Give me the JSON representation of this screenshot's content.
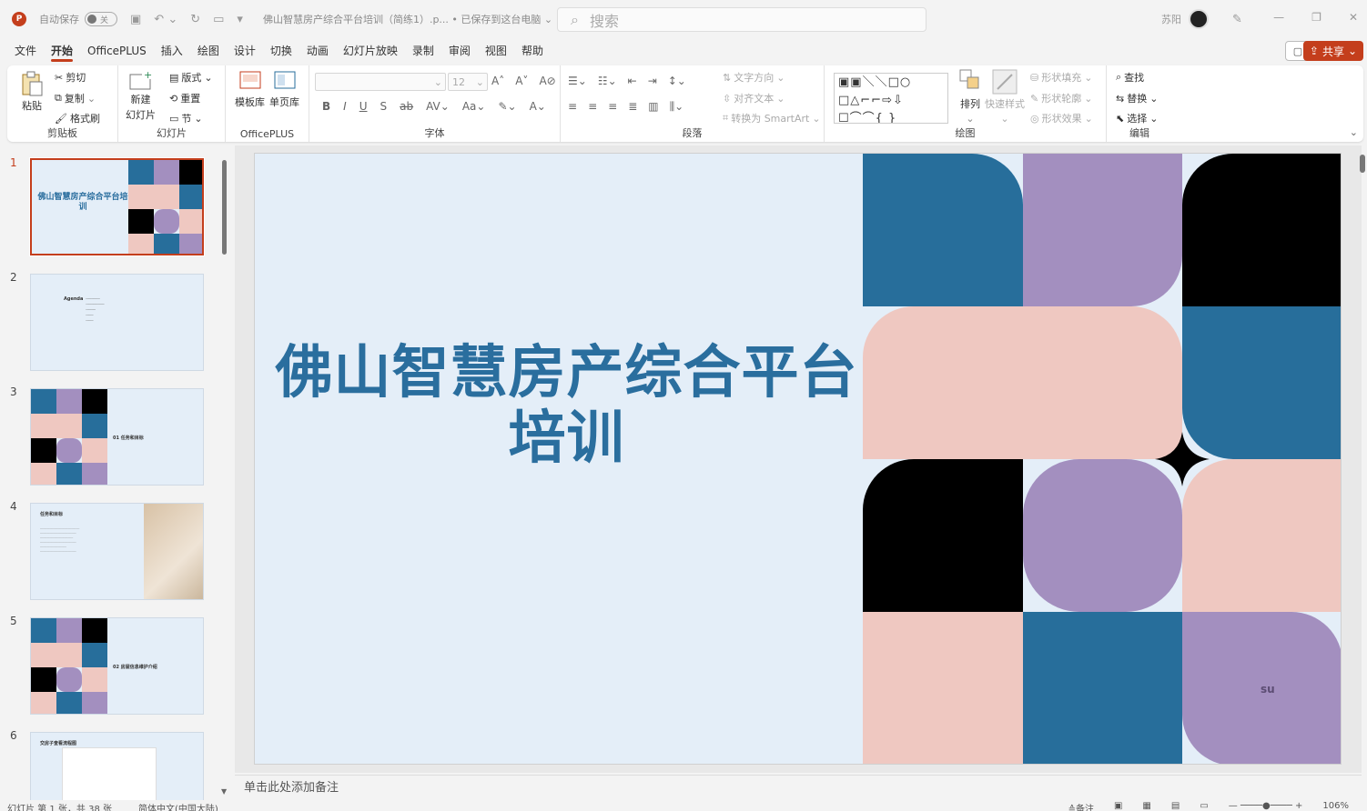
{
  "titlebar": {
    "autosave_label": "自动保存",
    "autosave_state": "关",
    "doc_title": "佛山智慧房产综合平台培训（简练1）.p...  • 已保存到这台电脑 ⌄",
    "search_placeholder": "搜索",
    "user_name": "苏阳"
  },
  "menu": {
    "tabs": [
      "文件",
      "开始",
      "OfficePLUS",
      "插入",
      "绘图",
      "设计",
      "切换",
      "动画",
      "幻灯片放映",
      "录制",
      "审阅",
      "视图",
      "帮助"
    ],
    "active": "开始",
    "share_label": "共享"
  },
  "ribbon": {
    "clipboard": {
      "paste": "粘贴",
      "cut": "剪切",
      "copy": "复制",
      "format_painter": "格式刷",
      "label": "剪贴板"
    },
    "slides": {
      "new_slide": "新建",
      "new_slide2": "幻灯片",
      "layout": "版式",
      "reset": "重置",
      "section": "节",
      "label": "幻灯片"
    },
    "officeplus": {
      "template": "模板库",
      "single_page": "单页库",
      "label": "OfficePLUS"
    },
    "font": {
      "size": "12",
      "label": "字体"
    },
    "paragraph": {
      "text_direction": "文字方向",
      "align_text": "对齐文本",
      "smartart": "转换为 SmartArt",
      "label": "段落"
    },
    "drawing": {
      "arrange": "排列",
      "quick_styles": "快速样式",
      "shape_fill": "形状填充",
      "shape_outline": "形状轮廓",
      "shape_effects": "形状效果",
      "label": "绘图"
    },
    "editing": {
      "find": "查找",
      "replace": "替换",
      "select": "选择",
      "label": "编辑"
    }
  },
  "thumbnails": [
    {
      "num": "1",
      "title": "佛山智慧房产综合平台培训"
    },
    {
      "num": "2",
      "title": "Agenda"
    },
    {
      "num": "3",
      "title": "01 任务和目标"
    },
    {
      "num": "4",
      "title": "任务和目标"
    },
    {
      "num": "5",
      "title": "02 房屋信息维护介绍"
    },
    {
      "num": "6",
      "title": "交房子查看流程图"
    }
  ],
  "slide": {
    "title_line1": "佛山智慧房产综合平台",
    "title_line2": "培训",
    "watermark": "su"
  },
  "notes_placeholder": "单击此处添加备注",
  "status": {
    "slide_info": "幻灯片 第 1 张，共 38 张",
    "language": "简体中文(中国大陆)",
    "notes": "备注",
    "zoom": "106%"
  },
  "colors": {
    "accent": "#c43e1c",
    "slide_bg": "#e4eef8",
    "title": "#2a6e9e",
    "blue": "#276e9b",
    "lavender": "#a38fbf",
    "pink": "#efc8c1",
    "black": "#000000"
  }
}
